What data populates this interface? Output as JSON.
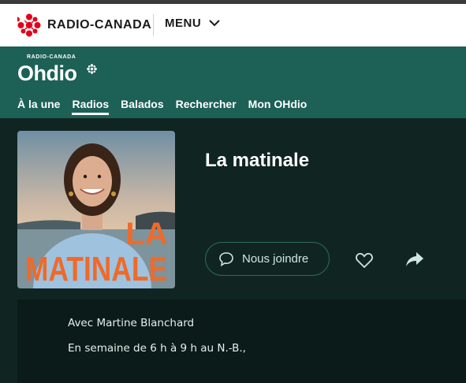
{
  "header": {
    "brand": "RADIO-CANADA",
    "menu_label": "MENU"
  },
  "ohdio": {
    "overline": "RADIO-CANADA",
    "wordmark": "Ohdio"
  },
  "nav": {
    "items": [
      {
        "label": "À la une"
      },
      {
        "label": "Radios",
        "active": true
      },
      {
        "label": "Balados"
      },
      {
        "label": "Rechercher"
      },
      {
        "label": "Mon OHdio"
      }
    ]
  },
  "show": {
    "title": "La matinale",
    "cover_text_line1": "LA",
    "cover_text_line2": "MATINALE",
    "contact_label": "Nous joindre",
    "host": "Avec Martine Blanchard",
    "schedule": "En semaine de 6 h à 9 h au N.-B.,"
  },
  "colors": {
    "brand_red": "#e2001a",
    "ohdio_green": "#1c6056",
    "cover_orange": "#ef6a2a"
  },
  "icons": [
    "cbc-gem-icon",
    "chevron-down-icon",
    "chat-bubble-icon",
    "heart-icon",
    "share-icon"
  ]
}
